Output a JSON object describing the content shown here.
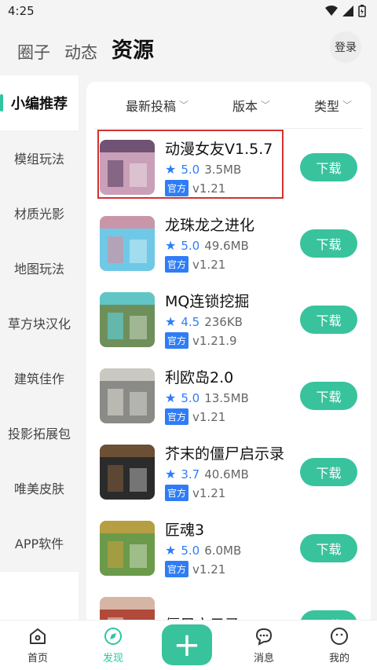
{
  "status": {
    "time": "4:25"
  },
  "header": {
    "tabs": [
      {
        "label": "圈子"
      },
      {
        "label": "动态"
      },
      {
        "label": "资源"
      }
    ],
    "login": "登录"
  },
  "sidebar": {
    "items": [
      {
        "label": "小编推荐"
      },
      {
        "label": "模组玩法"
      },
      {
        "label": "材质光影"
      },
      {
        "label": "地图玩法"
      },
      {
        "label": "草方块汉化"
      },
      {
        "label": "建筑佳作"
      },
      {
        "label": "投影拓展包"
      },
      {
        "label": "唯美皮肤"
      },
      {
        "label": "APP软件"
      }
    ]
  },
  "filters": [
    {
      "label": "最新投稿"
    },
    {
      "label": "版本"
    },
    {
      "label": "类型"
    }
  ],
  "resources": [
    {
      "title": "动漫女友V1.5.7",
      "rating": "5.0",
      "size": "3.5MB",
      "tag": "官方",
      "version": "v1.21",
      "thumb_color": "#c9a0b8",
      "thumb_accent": "#5a3f63"
    },
    {
      "title": "龙珠龙之进化",
      "rating": "5.0",
      "size": "49.6MB",
      "tag": "官方",
      "version": "v1.21",
      "thumb_color": "#6fc9e6",
      "thumb_accent": "#e08a9a"
    },
    {
      "title": "MQ连锁挖掘",
      "rating": "4.5",
      "size": "236KB",
      "tag": "官方",
      "version": "v1.21.9",
      "thumb_color": "#6f8f5a",
      "thumb_accent": "#5ed2e0"
    },
    {
      "title": "利欧岛2.0",
      "rating": "5.0",
      "size": "13.5MB",
      "tag": "官方",
      "version": "v1.21",
      "thumb_color": "#8a8a86",
      "thumb_accent": "#d8d8d0"
    },
    {
      "title": "芥末的僵尸启示录",
      "rating": "3.7",
      "size": "40.6MB",
      "tag": "官方",
      "version": "v1.21",
      "thumb_color": "#2b2b2b",
      "thumb_accent": "#7c5a3a"
    },
    {
      "title": "匠魂3",
      "rating": "5.0",
      "size": "6.0MB",
      "tag": "官方",
      "version": "v1.21",
      "thumb_color": "#6a9a4a",
      "thumb_accent": "#c8a040"
    },
    {
      "title": "僵尸启示录",
      "rating": "",
      "size": "",
      "tag": "",
      "version": "",
      "thumb_color": "#b14a3a",
      "thumb_accent": "#e0d0c0"
    }
  ],
  "download_label": "下载",
  "bottom_nav": [
    {
      "label": "首页"
    },
    {
      "label": "发现"
    },
    {
      "label": "消息"
    },
    {
      "label": "我的"
    }
  ],
  "fab": "+",
  "colors": {
    "accent": "#38c39d",
    "blue": "#2f7df6",
    "highlight": "#d63030"
  }
}
